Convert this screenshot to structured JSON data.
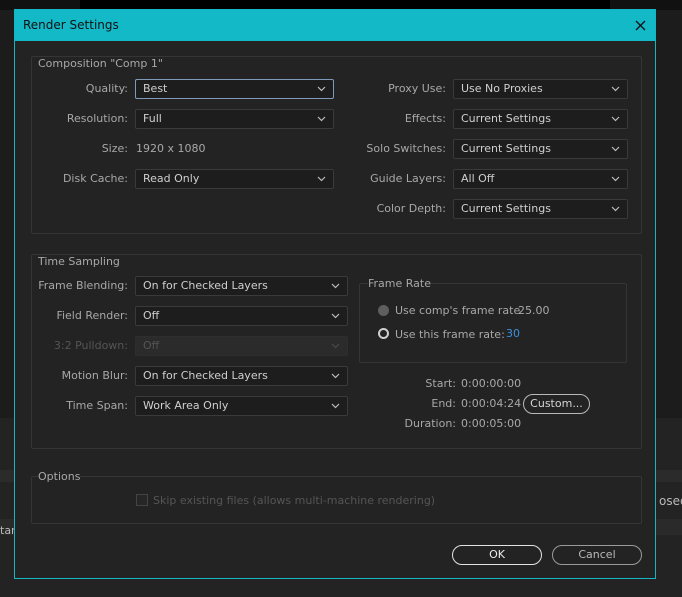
{
  "background": {
    "left_fragment": "tart",
    "right_fragment": "osed"
  },
  "dialog": {
    "title": "Render Settings",
    "composition": {
      "group_title": "Composition \"Comp 1\"",
      "quality": {
        "label": "Quality:",
        "value": "Best"
      },
      "resolution": {
        "label": "Resolution:",
        "value": "Full"
      },
      "size": {
        "label": "Size:",
        "value": "1920 x 1080"
      },
      "disk_cache": {
        "label": "Disk Cache:",
        "value": "Read Only"
      },
      "proxy_use": {
        "label": "Proxy Use:",
        "value": "Use No Proxies"
      },
      "effects": {
        "label": "Effects:",
        "value": "Current Settings"
      },
      "solo_switches": {
        "label": "Solo Switches:",
        "value": "Current Settings"
      },
      "guide_layers": {
        "label": "Guide Layers:",
        "value": "All Off"
      },
      "color_depth": {
        "label": "Color Depth:",
        "value": "Current Settings"
      }
    },
    "time_sampling": {
      "group_title": "Time Sampling",
      "frame_blending": {
        "label": "Frame Blending:",
        "value": "On for Checked Layers"
      },
      "field_render": {
        "label": "Field Render:",
        "value": "Off"
      },
      "pulldown": {
        "label": "3:2 Pulldown:",
        "value": "Off"
      },
      "motion_blur": {
        "label": "Motion Blur:",
        "value": "On for Checked Layers"
      },
      "time_span": {
        "label": "Time Span:",
        "value": "Work Area Only"
      },
      "frame_rate": {
        "group_title": "Frame Rate",
        "use_comp_label": "Use comp's frame rate",
        "comp_rate": "25.00",
        "use_this_label": "Use this frame rate:",
        "this_rate": "30",
        "selected": "use_this"
      },
      "start": {
        "label": "Start:",
        "value": "0:00:00:00"
      },
      "end": {
        "label": "End:",
        "value": "0:00:04:24"
      },
      "duration": {
        "label": "Duration:",
        "value": "0:00:05:00"
      },
      "custom_button": "Custom..."
    },
    "options": {
      "group_title": "Options",
      "skip_existing": {
        "label": "Skip existing files (allows multi-machine rendering)",
        "checked": false
      }
    },
    "ok_button": "OK",
    "cancel_button": "Cancel"
  },
  "colors": {
    "titlebar": "#14b9c7",
    "accent_value": "#3b8fe0"
  }
}
